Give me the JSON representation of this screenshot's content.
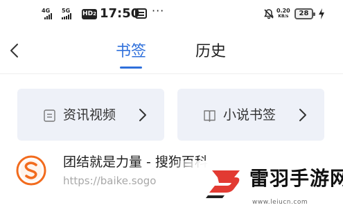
{
  "status_bar": {
    "signal_1_label": "4G",
    "signal_2_label": "5G",
    "hd_label": "HD",
    "hd_sub": "2",
    "time": "17:50",
    "net_speed_value": "0.20",
    "net_speed_unit": "KB/s",
    "battery_level": "28"
  },
  "header": {
    "tabs": [
      {
        "label": "书签",
        "active": true
      },
      {
        "label": "历史",
        "active": false
      }
    ],
    "accent_color": "#2e6fdb"
  },
  "categories": [
    {
      "label": "资讯视频",
      "icon": "document-icon"
    },
    {
      "label": "小说书签",
      "icon": "book-icon"
    }
  ],
  "bookmarks": [
    {
      "title": "团结就是力量 - 搜狗百科",
      "url": "https://baike.sogo",
      "icon": "sogou-logo"
    }
  ],
  "watermark": {
    "name": "雷羽手游网",
    "url": "www.leiucn.com"
  }
}
